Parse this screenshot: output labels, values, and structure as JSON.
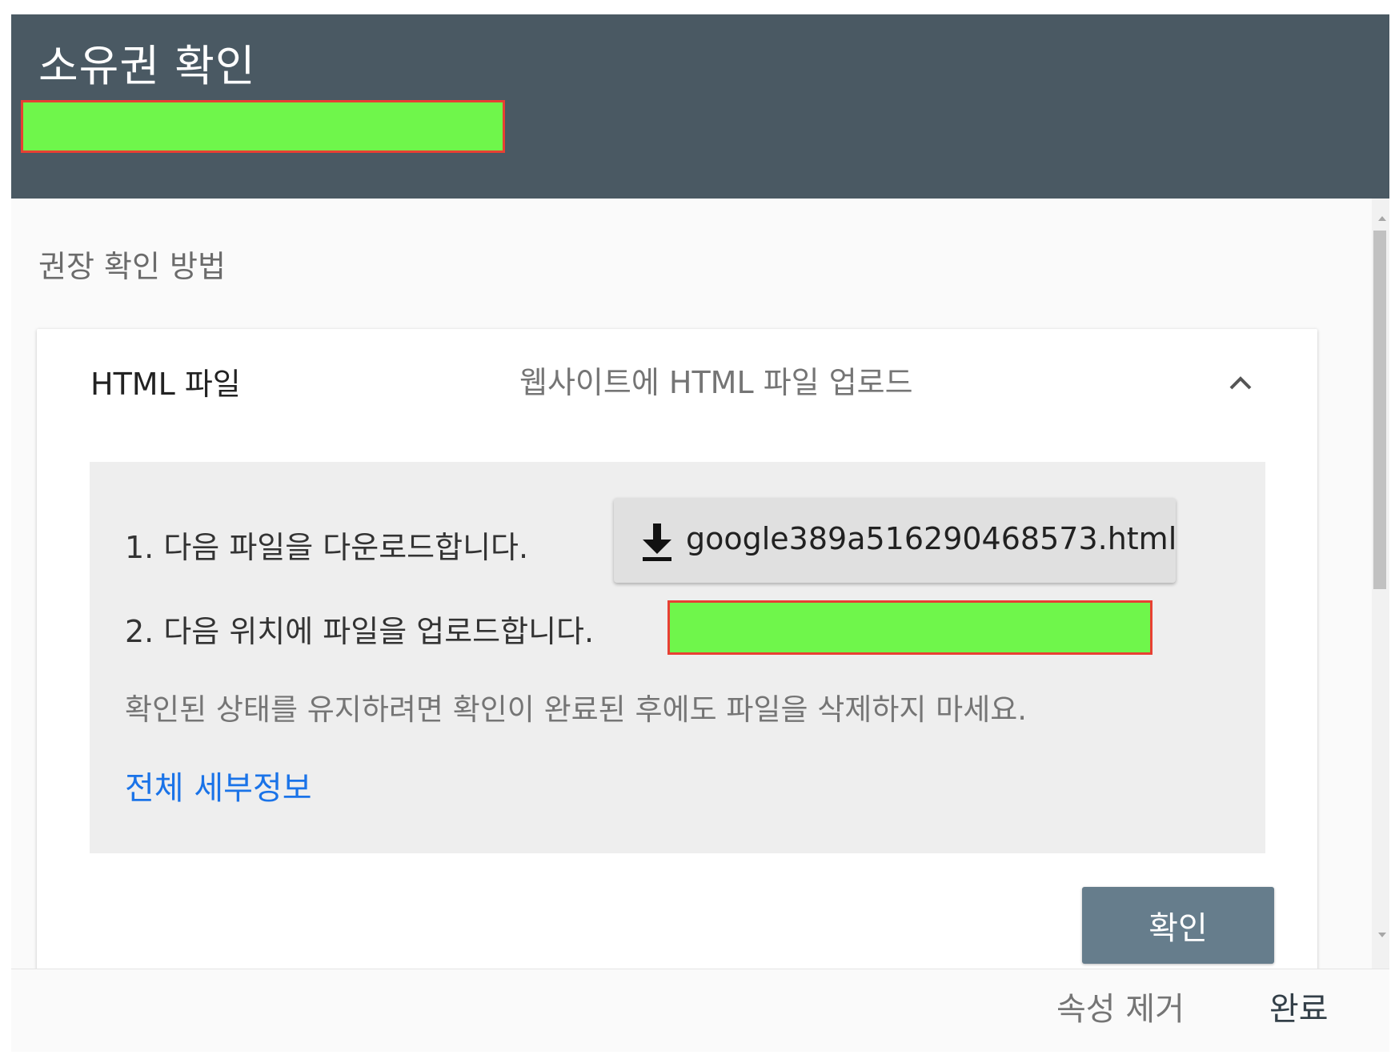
{
  "dialog": {
    "title": "소유권 확인"
  },
  "recommended": {
    "heading": "권장 확인 방법"
  },
  "method": {
    "name": "HTML 파일",
    "description": "웹사이트에 HTML 파일 업로드",
    "collapse_icon": "chevron-up-icon",
    "step1": "1. 다음 파일을 다운로드합니다.",
    "download_icon": "download-icon",
    "download_file": "google389a516290468573.html",
    "step2": "2. 다음 위치에 파일을 업로드합니다.",
    "note": "확인된 상태를 유지하려면 확인이 완료된 후에도 파일을 삭제하지 마세요.",
    "details_link": "전체 세부정보",
    "verify_label": "확인"
  },
  "footer": {
    "remove_label": "속성 제거",
    "done_label": "완료"
  },
  "colors": {
    "header_bg": "#4a5963",
    "verify_bg": "#667d8c",
    "link": "#1a73e8",
    "redaction_fill": "#6ff64b",
    "redaction_border": "#e84033"
  }
}
